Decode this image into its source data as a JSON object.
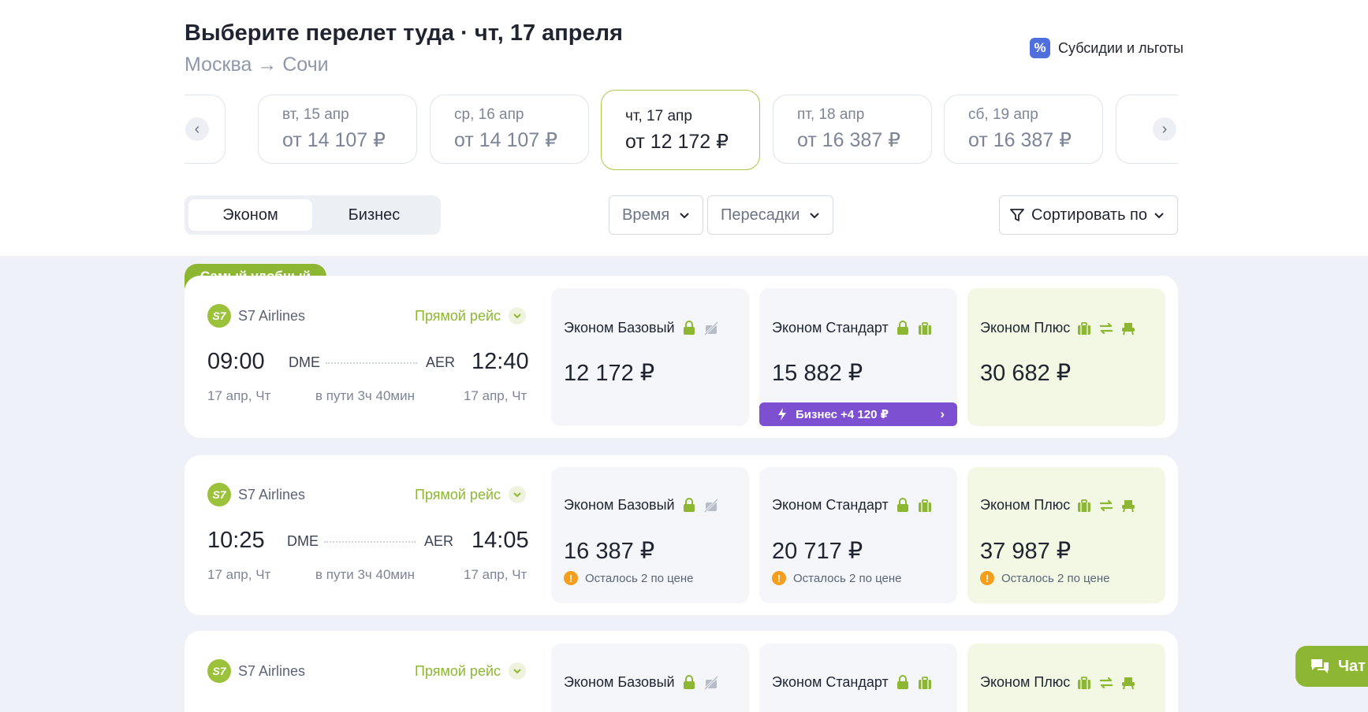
{
  "header": {
    "title": "Выберите перелет туда · чт, 17 апреля",
    "route": "Москва → Сочи",
    "subsidies_label": "Субсидии и льготы"
  },
  "dates": [
    {
      "day": "вт, 15 апр",
      "price": "от 14 107 ₽"
    },
    {
      "day": "ср, 16 апр",
      "price": "от 14 107 ₽"
    },
    {
      "day": "чт, 17 апр",
      "price": "от 12 172 ₽",
      "active": true
    },
    {
      "day": "пт, 18 апр",
      "price": "от 16 387 ₽"
    },
    {
      "day": "сб, 19 апр",
      "price": "от 16 387 ₽"
    }
  ],
  "class_tabs": [
    "Эконом",
    "Бизнес"
  ],
  "filters": {
    "time": "Время",
    "transfers": "Пересадки",
    "sort": "Сортировать по"
  },
  "badge_label": "Самый удобный",
  "fare_names": {
    "basic": "Эконом Базовый",
    "standard": "Эконом Стандарт",
    "plus": "Эконом Плюс"
  },
  "flights": [
    {
      "airline": "S7 Airlines",
      "direct": "Прямой рейс",
      "dep_time": "09:00",
      "arr_time": "12:40",
      "dep_code": "DME",
      "arr_code": "AER",
      "dep_date": "17 апр, Чт",
      "arr_date": "17 апр, Чт",
      "duration": "в пути 3ч 40мин",
      "prices": {
        "basic": "12 172 ₽",
        "standard": "15 882 ₽",
        "plus": "30 682 ₽"
      },
      "upgrade": "Бизнес +4 120 ₽"
    },
    {
      "airline": "S7 Airlines",
      "direct": "Прямой рейс",
      "dep_time": "10:25",
      "arr_time": "14:05",
      "dep_code": "DME",
      "arr_code": "AER",
      "dep_date": "17 апр, Чт",
      "arr_date": "17 апр, Чт",
      "duration": "в пути 3ч 40мин",
      "prices": {
        "basic": "16 387 ₽",
        "standard": "20 717 ₽",
        "plus": "37 987 ₽"
      },
      "left_note": "Осталось 2 по цене"
    },
    {
      "airline": "S7 Airlines",
      "direct": "Прямой рейс"
    }
  ],
  "logo_text": "S7",
  "chat_label": "Чат",
  "colors": {
    "accent": "#8db733",
    "upgrade": "#7d4fd1",
    "warning": "#f59e1b",
    "plus_bg": "#f2f8e4"
  }
}
